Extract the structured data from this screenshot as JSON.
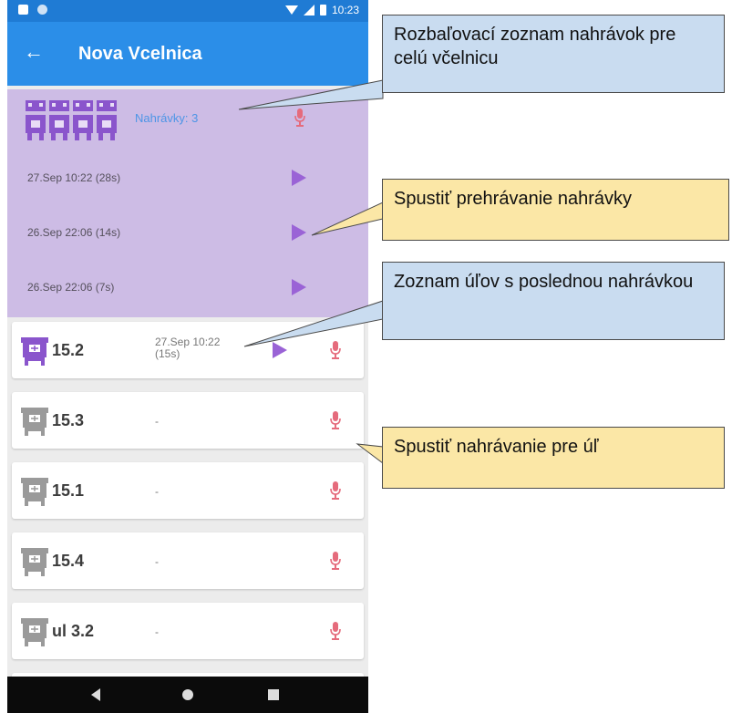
{
  "status_bar": {
    "time": "10:23"
  },
  "app_bar": {
    "back_glyph": "←",
    "title": "Nova Vcelnica"
  },
  "hive_card": {
    "recordings_label": "Nahrávky: 3",
    "recordings": [
      {
        "label": "27.Sep 10:22 (28s)"
      },
      {
        "label": "26.Sep 22:06 (14s)"
      },
      {
        "label": "26.Sep 22:06 (7s)"
      }
    ]
  },
  "hives": [
    {
      "name": "15.2",
      "last_line1": "27.Sep 10:22",
      "last_line2": "(15s)",
      "has_recording": true
    },
    {
      "name": "15.3",
      "last_line1": "-",
      "last_line2": "",
      "has_recording": false
    },
    {
      "name": "15.1",
      "last_line1": "-",
      "last_line2": "",
      "has_recording": false
    },
    {
      "name": "15.4",
      "last_line1": "-",
      "last_line2": "",
      "has_recording": false
    },
    {
      "name": "ul 3.2",
      "last_line1": "-",
      "last_line2": "",
      "has_recording": false
    }
  ],
  "callouts": {
    "c1": "Rozbaľovací zoznam nahrávok pre celú včelnicu",
    "c2": "Spustiť prehrávanie nahrávky",
    "c3": "Zoznam úľov s poslednou nahrávkou",
    "c4": "Spustiť nahrávanie pre úľ"
  },
  "colors": {
    "app_bar": "#2b8ee8",
    "status_bar": "#1f7bd4",
    "hive_card": "#cdbce5",
    "play": "#9a63d6",
    "mic": "#e56b7c",
    "count_text": "#4d95e6",
    "callout_blue": "#c9dcf0",
    "callout_yellow": "#fbe7a6"
  },
  "icons": [
    "back-arrow-icon",
    "apiary-icon",
    "beehive-icon",
    "play-icon",
    "microphone-icon",
    "wifi-icon",
    "signal-icon",
    "battery-icon"
  ]
}
